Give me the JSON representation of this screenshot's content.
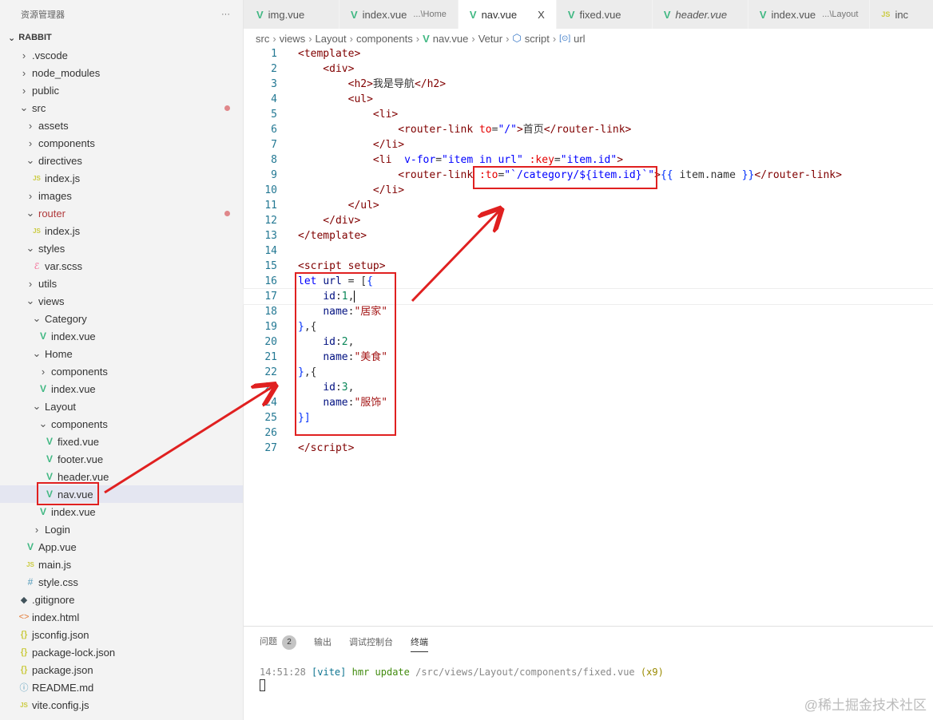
{
  "sidebar": {
    "title": "资源管理器",
    "more": "···",
    "root": "RABBIT",
    "items": [
      {
        "label": ".vscode",
        "level": 0,
        "icon": "chevron-right"
      },
      {
        "label": "node_modules",
        "level": 0,
        "icon": "chevron-right"
      },
      {
        "label": "public",
        "level": 0,
        "icon": "chevron-right"
      },
      {
        "label": "src",
        "level": 0,
        "icon": "chevron-down",
        "modified": true
      },
      {
        "label": "assets",
        "level": 1,
        "icon": "chevron-right"
      },
      {
        "label": "components",
        "level": 1,
        "icon": "chevron-right"
      },
      {
        "label": "directives",
        "level": 1,
        "icon": "chevron-down"
      },
      {
        "label": "index.js",
        "level": 2,
        "icon": "js"
      },
      {
        "label": "images",
        "level": 1,
        "icon": "chevron-right"
      },
      {
        "label": "router",
        "level": 1,
        "icon": "chevron-down",
        "modified": true
      },
      {
        "label": "index.js",
        "level": 2,
        "icon": "js"
      },
      {
        "label": "styles",
        "level": 1,
        "icon": "chevron-down"
      },
      {
        "label": "var.scss",
        "level": 2,
        "icon": "scss"
      },
      {
        "label": "utils",
        "level": 1,
        "icon": "chevron-right"
      },
      {
        "label": "views",
        "level": 1,
        "icon": "chevron-down"
      },
      {
        "label": "Category",
        "level": 2,
        "icon": "chevron-down"
      },
      {
        "label": "index.vue",
        "level": 3,
        "icon": "vue"
      },
      {
        "label": "Home",
        "level": 2,
        "icon": "chevron-down"
      },
      {
        "label": "components",
        "level": 3,
        "icon": "chevron-right"
      },
      {
        "label": "index.vue",
        "level": 3,
        "icon": "vue"
      },
      {
        "label": "Layout",
        "level": 2,
        "icon": "chevron-down"
      },
      {
        "label": "components",
        "level": 3,
        "icon": "chevron-down"
      },
      {
        "label": "fixed.vue",
        "level": 4,
        "icon": "vue"
      },
      {
        "label": "footer.vue",
        "level": 4,
        "icon": "vue"
      },
      {
        "label": "header.vue",
        "level": 4,
        "icon": "vue"
      },
      {
        "label": "nav.vue",
        "level": 4,
        "icon": "vue",
        "selected": true
      },
      {
        "label": "index.vue",
        "level": 3,
        "icon": "vue"
      },
      {
        "label": "Login",
        "level": 2,
        "icon": "chevron-right"
      },
      {
        "label": "App.vue",
        "level": 1,
        "icon": "vue"
      },
      {
        "label": "main.js",
        "level": 1,
        "icon": "js"
      },
      {
        "label": "style.css",
        "level": 1,
        "icon": "css"
      },
      {
        "label": ".gitignore",
        "level": 0,
        "icon": "git"
      },
      {
        "label": "index.html",
        "level": 0,
        "icon": "html"
      },
      {
        "label": "jsconfig.json",
        "level": 0,
        "icon": "json"
      },
      {
        "label": "package-lock.json",
        "level": 0,
        "icon": "json"
      },
      {
        "label": "package.json",
        "level": 0,
        "icon": "json"
      },
      {
        "label": "README.md",
        "level": 0,
        "icon": "info"
      },
      {
        "label": "vite.config.js",
        "level": 0,
        "icon": "js"
      }
    ]
  },
  "tabs": [
    {
      "label": "img.vue",
      "sub": "",
      "icon": "vue"
    },
    {
      "label": "index.vue",
      "sub": "...\\Home",
      "icon": "vue"
    },
    {
      "label": "nav.vue",
      "sub": "",
      "icon": "vue",
      "active": true,
      "close": "X"
    },
    {
      "label": "fixed.vue",
      "sub": "",
      "icon": "vue"
    },
    {
      "label": "header.vue",
      "sub": "",
      "icon": "vue",
      "italic": true
    },
    {
      "label": "index.vue",
      "sub": "...\\Layout",
      "icon": "vue"
    },
    {
      "label": "inc",
      "sub": "",
      "icon": "js"
    }
  ],
  "breadcrumb": [
    "src",
    "views",
    "Layout",
    "components",
    "nav.vue",
    "Vetur",
    "script",
    "url"
  ],
  "code": [
    [
      [
        "<template>",
        "t"
      ]
    ],
    [
      [
        "    <div>",
        "t"
      ]
    ],
    [
      [
        "        <h2>",
        "t"
      ],
      [
        "我是导航",
        "p"
      ],
      [
        "</h2>",
        "t"
      ]
    ],
    [
      [
        "        <ul>",
        "t"
      ]
    ],
    [
      [
        "            <li>",
        "t"
      ]
    ],
    [
      [
        "                <router-link ",
        "t"
      ],
      [
        "to",
        "a"
      ],
      [
        "=",
        "p"
      ],
      [
        "\"/\"",
        "s"
      ],
      [
        ">",
        "t"
      ],
      [
        "首页",
        "p"
      ],
      [
        "</router-link>",
        "t"
      ]
    ],
    [
      [
        "            </li>",
        "t"
      ]
    ],
    [
      [
        "            <li  ",
        "t"
      ],
      [
        "v-for",
        "s"
      ],
      [
        "=",
        "p"
      ],
      [
        "\"item in url\"",
        "s"
      ],
      [
        " ",
        "p"
      ],
      [
        ":key",
        "a"
      ],
      [
        "=",
        "p"
      ],
      [
        "\"item.id\"",
        "s"
      ],
      [
        ">",
        "t"
      ]
    ],
    [
      [
        "                <router-link ",
        "t"
      ],
      [
        ":to",
        "a"
      ],
      [
        "=",
        "p"
      ],
      [
        "\"`/category/${item.id}`\"",
        "s"
      ],
      [
        ">",
        "t"
      ],
      [
        "{{",
        "b"
      ],
      [
        " item.name ",
        "p"
      ],
      [
        "}}",
        "b"
      ],
      [
        "</router-link>",
        "t"
      ]
    ],
    [
      [
        "            </li>",
        "t"
      ]
    ],
    [
      [
        "        </ul>",
        "t"
      ]
    ],
    [
      [
        "    </div>",
        "t"
      ]
    ],
    [
      [
        "</template>",
        "t"
      ]
    ],
    [],
    [
      [
        "<script setup>",
        "t"
      ]
    ],
    [
      [
        "let",
        "k"
      ],
      [
        " ",
        "p"
      ],
      [
        "url",
        "v"
      ],
      [
        " = [",
        "p"
      ],
      [
        "{",
        "b"
      ]
    ],
    [
      [
        "    ",
        "p"
      ],
      [
        "id",
        "v"
      ],
      [
        ":",
        "p"
      ],
      [
        "1",
        "n"
      ],
      [
        ",",
        "p"
      ]
    ],
    [
      [
        "    ",
        "p"
      ],
      [
        "name",
        "v"
      ],
      [
        ":",
        "p"
      ],
      [
        "\"居家\"",
        "str"
      ]
    ],
    [
      [
        "}",
        "b"
      ],
      [
        ",{",
        "p"
      ]
    ],
    [
      [
        "    ",
        "p"
      ],
      [
        "id",
        "v"
      ],
      [
        ":",
        "p"
      ],
      [
        "2",
        "n"
      ],
      [
        ",",
        "p"
      ]
    ],
    [
      [
        "    ",
        "p"
      ],
      [
        "name",
        "v"
      ],
      [
        ":",
        "p"
      ],
      [
        "\"美食\"",
        "str"
      ]
    ],
    [
      [
        "}",
        "b"
      ],
      [
        ",{",
        "p"
      ]
    ],
    [
      [
        "    ",
        "p"
      ],
      [
        "id",
        "v"
      ],
      [
        ":",
        "p"
      ],
      [
        "3",
        "n"
      ],
      [
        ",",
        "p"
      ]
    ],
    [
      [
        "    ",
        "p"
      ],
      [
        "name",
        "v"
      ],
      [
        ":",
        "p"
      ],
      [
        "\"服饰\"",
        "str"
      ]
    ],
    [
      [
        "}]",
        "b"
      ]
    ],
    [],
    [
      [
        "</script>",
        "t"
      ]
    ]
  ],
  "panel": {
    "tabs": [
      {
        "label": "问题",
        "badge": "2"
      },
      {
        "label": "输出"
      },
      {
        "label": "调试控制台"
      },
      {
        "label": "终端",
        "active": true
      }
    ],
    "terminal": {
      "time": "14:51:28",
      "tag": "[vite]",
      "cmd": "hmr update",
      "path": "/src/views/Layout/components/fixed.vue",
      "count": "(x9)"
    }
  },
  "watermark": "@稀土掘金技术社区",
  "colors": {
    "annotation": "#e02020",
    "selection": "#e4e6f1"
  }
}
